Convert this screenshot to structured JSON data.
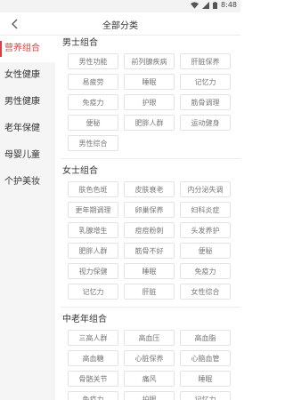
{
  "status": {
    "time": "8:48"
  },
  "header": {
    "title": "全部分类"
  },
  "sidebar": {
    "items": [
      {
        "label": "营养组合"
      },
      {
        "label": "女性健康"
      },
      {
        "label": "男性健康"
      },
      {
        "label": "老年保健"
      },
      {
        "label": "母婴儿童"
      },
      {
        "label": "个护美妆"
      }
    ]
  },
  "groups": [
    {
      "title": "男士组合",
      "items": [
        "男性功能",
        "前列腺疾病",
        "肝脏保养",
        "易疲劳",
        "睡眠",
        "记忆力",
        "免疫力",
        "护眼",
        "筋骨调理",
        "便秘",
        "肥胖人群",
        "运动健身",
        "男性综合"
      ]
    },
    {
      "title": "女士组合",
      "items": [
        "肤色色斑",
        "皮肤衰老",
        "内分泌失调",
        "更年期调理",
        "卵巢保养",
        "妇科炎症",
        "乳腺增生",
        "痘痘粉刺",
        "头发养护",
        "肥胖人群",
        "筋骨不好",
        "便秘",
        "视力保健",
        "睡眠",
        "免疫力",
        "记忆力",
        "肝脏",
        "女性综合"
      ]
    },
    {
      "title": "中老年组合",
      "items": [
        "三高人群",
        "高血压",
        "高血脂",
        "高血糖",
        "心脏保养",
        "心脑血管",
        "骨骼关节",
        "痛风",
        "睡眠",
        "免疫力",
        "护眼",
        "记忆力"
      ]
    }
  ]
}
